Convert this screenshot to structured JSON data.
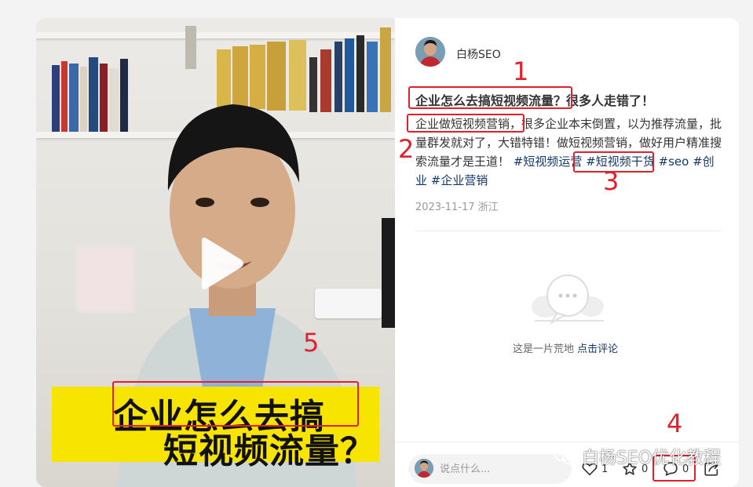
{
  "post": {
    "author": "白杨SEO",
    "title": "企业怎么去搞短视频流量？很多人走错了！",
    "desc_text": "企业做短视频营销，很多企业本末倒置，以为推荐流量，批量群发就对了，大错特错！做短视频营销，做好用户精准搜索流量才是王道！",
    "tags": [
      "#短视频运营",
      "#短视频干货",
      "#seo",
      "#创业",
      "#企业营销"
    ],
    "date_location": "2023-11-17 浙江"
  },
  "video": {
    "caption_line1": "企业怎么去搞",
    "caption_line2": "短视频流量？"
  },
  "comments": {
    "empty_text": "这是一片荒地",
    "empty_link": "点击评论",
    "input_placeholder": "说点什么..."
  },
  "actions": {
    "like_count": "1",
    "collect_count": "0",
    "comment_count": "0"
  },
  "annotations": [
    "1",
    "2",
    "3",
    "4",
    "5"
  ],
  "watermark": "白杨SEO优化教程",
  "icons": [
    "play-icon",
    "heart-icon",
    "star-icon",
    "comment-icon",
    "share-icon",
    "wechat-icon"
  ],
  "colors": {
    "annotation": "#e0202a",
    "tag_link": "#13386c",
    "caption_bg": "#f7e400"
  }
}
